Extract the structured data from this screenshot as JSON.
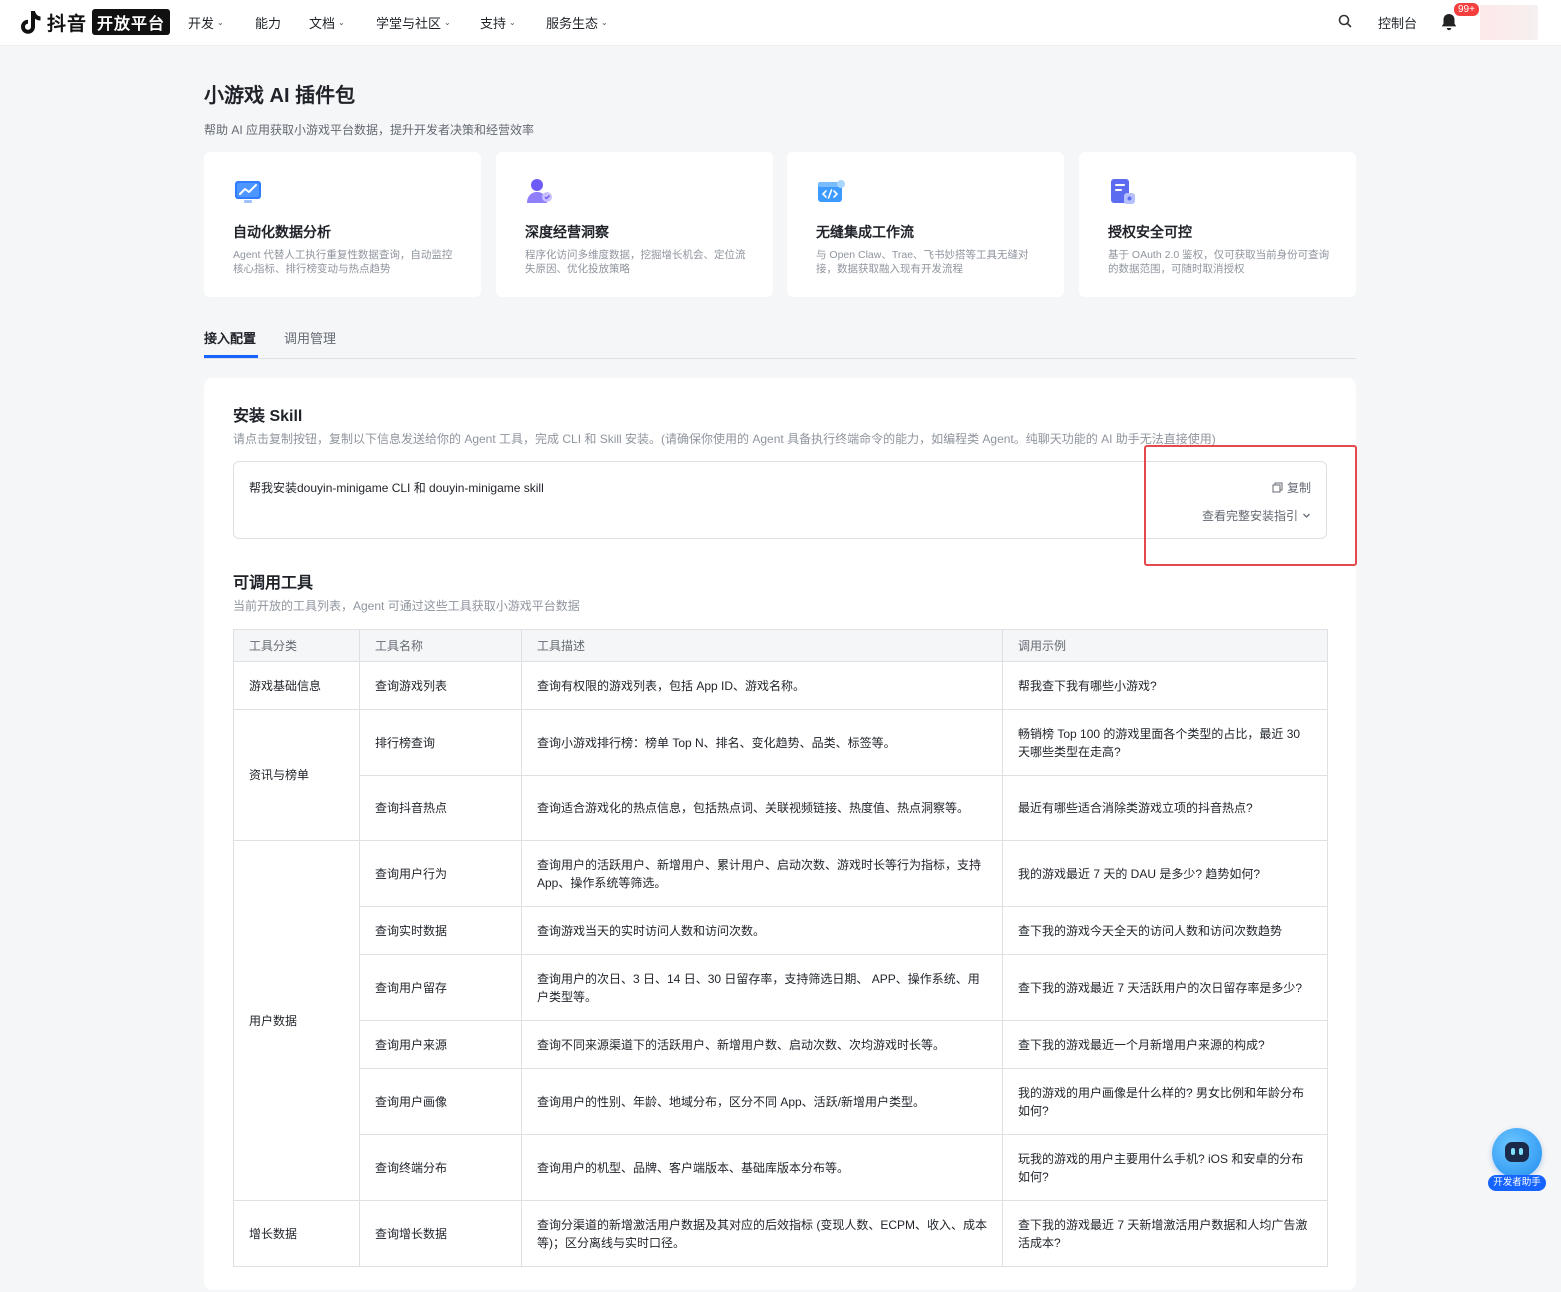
{
  "nav": {
    "logo_text": "抖音",
    "logo_badge": "开放平台",
    "items": [
      {
        "label": "开发",
        "caret": true
      },
      {
        "label": "能力",
        "caret": false
      },
      {
        "label": "文档",
        "caret": true
      },
      {
        "label": "学堂与社区",
        "caret": true
      },
      {
        "label": "支持",
        "caret": true
      },
      {
        "label": "服务生态",
        "caret": true
      }
    ],
    "console": "控制台",
    "notification_count": "99+"
  },
  "header": {
    "title": "小游戏 AI 插件包",
    "subtitle": "帮助 AI 应用获取小游戏平台数据，提升开发者决策和经营效率"
  },
  "features": [
    {
      "icon": "chart-monitor-icon",
      "title": "自动化数据分析",
      "desc": "Agent 代替人工执行重复性数据查询，自动监控核心指标、排行榜变动与热点趋势"
    },
    {
      "icon": "user-insight-icon",
      "title": "深度经营洞察",
      "desc": "程序化访问多维度数据，挖掘增长机会、定位流失原因、优化投放策略"
    },
    {
      "icon": "code-window-icon",
      "title": "无缝集成工作流",
      "desc": "与 Open Claw、Trae、飞书妙搭等工具无缝对接，数据获取融入现有开发流程"
    },
    {
      "icon": "secure-doc-icon",
      "title": "授权安全可控",
      "desc": "基于 OAuth 2.0 鉴权，仅可获取当前身份可查询的数据范围，可随时取消授权"
    }
  ],
  "tabs": [
    {
      "label": "接入配置",
      "active": true
    },
    {
      "label": "调用管理",
      "active": false
    }
  ],
  "install": {
    "title": "安装 Skill",
    "desc": "请点击复制按钮，复制以下信息发送给你的 Agent 工具，完成 CLI 和 Skill 安装。(请确保你使用的 Agent 具备执行终端命令的能力，如编程类 Agent。纯聊天功能的 AI 助手无法直接使用)",
    "command": "帮我安装douyin-minigame CLI 和 douyin-minigame skill",
    "copy_label": "复制",
    "guide_label": "查看完整安装指引"
  },
  "tools": {
    "title": "可调用工具",
    "desc": "当前开放的工具列表，Agent 可通过这些工具获取小游戏平台数据",
    "headers": [
      "工具分类",
      "工具名称",
      "工具描述",
      "调用示例"
    ],
    "groups": [
      {
        "category": "游戏基础信息",
        "rows": [
          {
            "name": "查询游戏列表",
            "desc": "查询有权限的游戏列表，包括 App ID、游戏名称。",
            "example": "帮我查下我有哪些小游戏?",
            "height": 48
          }
        ]
      },
      {
        "category": "资讯与榜单",
        "rows": [
          {
            "name": "排行榜查询",
            "desc": "查询小游戏排行榜：榜单 Top N、排名、变化趋势、品类、标签等。",
            "example": "畅销榜 Top 100 的游戏里面各个类型的占比，最近 30 天哪些类型在走高?",
            "height": 66
          },
          {
            "name": "查询抖音热点",
            "desc": "查询适合游戏化的热点信息，包括热点词、关联视频链接、热度值、热点洞察等。",
            "example": "最近有哪些适合消除类游戏立项的抖音热点?",
            "height": 65
          }
        ]
      },
      {
        "category": "用户数据",
        "rows": [
          {
            "name": "查询用户行为",
            "desc": "查询用户的活跃用户、新增用户、累计用户、启动次数、游戏时长等行为指标，支持 App、操作系统等筛选。",
            "example": "我的游戏最近 7 天的 DAU 是多少? 趋势如何?",
            "height": 66
          },
          {
            "name": "查询实时数据",
            "desc": "查询游戏当天的实时访问人数和访问次数。",
            "example": "查下我的游戏今天全天的访问人数和访问次数趋势",
            "height": 48
          },
          {
            "name": "查询用户留存",
            "desc": "查询用户的次日、3 日、14 日、30 日留存率，支持筛选日期、 APP、操作系统、用户类型等。",
            "example": "查下我的游戏最近 7 天活跃用户的次日留存率是多少?",
            "height": 66
          },
          {
            "name": "查询用户来源",
            "desc": "查询不同来源渠道下的活跃用户、新增用户数、启动次数、次均游戏时长等。",
            "example": "查下我的游戏最近一个月新增用户来源的构成?",
            "height": 48
          },
          {
            "name": "查询用户画像",
            "desc": "查询用户的性别、年龄、地域分布，区分不同 App、活跃/新增用户类型。",
            "example": "我的游戏的用户画像是什么样的? 男女比例和年龄分布如何?",
            "height": 66
          },
          {
            "name": "查询终端分布",
            "desc": "查询用户的机型、品牌、客户端版本、基础库版本分布等。",
            "example": "玩我的游戏的用户主要用什么手机? iOS 和安卓的分布如何?",
            "height": 66
          }
        ]
      },
      {
        "category": "增长数据",
        "rows": [
          {
            "name": "查询增长数据",
            "desc": "查询分渠道的新增激活用户数据及其对应的后效指标 (变现人数、ECPM、收入、成本等)；区分离线与实时口径。",
            "example": "查下我的游戏最近 7 天新增激活用户数据和人均广告激活成本?",
            "height": 66
          }
        ]
      }
    ]
  },
  "assistant": {
    "label": "开发者助手"
  }
}
